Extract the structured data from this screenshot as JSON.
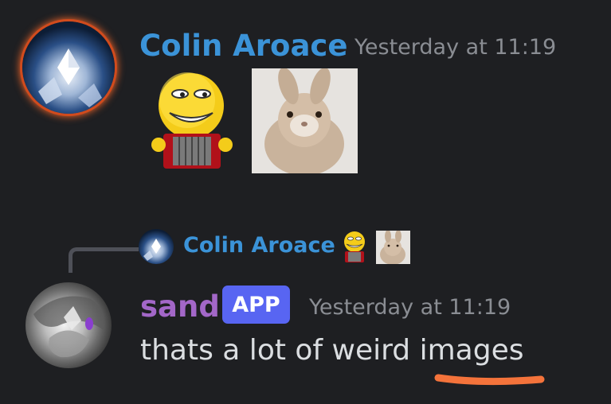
{
  "messages": [
    {
      "author": "Colin Aroace",
      "author_color": "#3b93d8",
      "timestamp": "Yesterday at 11:19",
      "attachments": [
        "accordion-smiley-emoji",
        "bunny-photo"
      ]
    },
    {
      "author": "sand",
      "author_color": "#a367c8",
      "badge": "APP",
      "timestamp": "Yesterday at 11:19",
      "content": "thats a lot of weird images",
      "reply_to": {
        "author": "Colin Aroace",
        "attachments": [
          "accordion-smiley-emoji",
          "bunny-photo"
        ]
      }
    }
  ],
  "colors": {
    "background": "#1e1f22",
    "timestamp": "#8a8d93",
    "message_text": "#dbdee1",
    "badge_bg": "#5865f2",
    "annotation_underline": "#f4733b"
  }
}
